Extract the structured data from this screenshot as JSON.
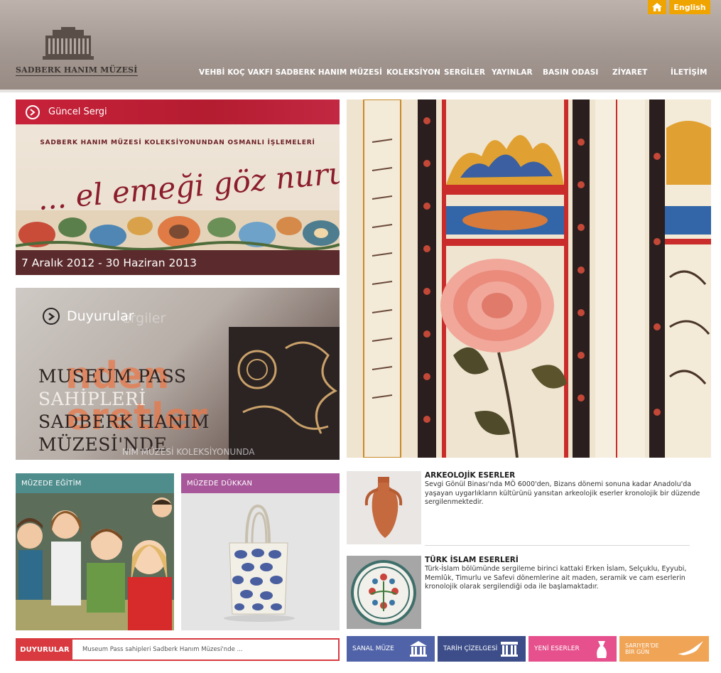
{
  "header": {
    "logo_text": "SADBERK HANIM MÜZESİ",
    "language_button": "English",
    "nav": [
      "VEHBİ KOÇ VAKFI SADBERK HANIM MÜZESİ",
      "KOLEKSİYON",
      "SERGİLER",
      "YAYINLAR",
      "BASIN ODASI",
      "ZİYARET",
      "İLETİŞİM"
    ]
  },
  "exhibition": {
    "label": "Güncel Sergi",
    "subtitle": "SADBERK HANIM MÜZESİ KOLEKSİYONUNDAN OSMANLI İŞLEMELERİ",
    "title": "... el emeği göz nuru",
    "dates": "7 Aralık 2012 - 30 Haziran 2013"
  },
  "announcement": {
    "label": "Duyurular",
    "ghost_text": "ergiler",
    "overlay_text": "nden",
    "overlay_text_2": "eretler",
    "lines": [
      "MUSEUM PASS",
      "SAHİPLERİ",
      "SADBERK HANIM",
      "MÜZESİ'NDE"
    ],
    "footer_text": "NIM MÜZESİ KOLEKSİYONUNDA"
  },
  "tiles": {
    "education": "MÜZEDE EĞİTİM",
    "shop": "MÜZEDE DÜKKAN"
  },
  "items": [
    {
      "title": "ARKEOLOJİK ESERLER",
      "text": "Sevgi Gönül Binası'nda MÖ 6000'den, Bizans dönemi sonuna kadar Anadolu'da yaşayan uygarlıkların kültürünü yansıtan arkeolojik eserler kronolojik bir düzende sergilenmektedir."
    },
    {
      "title": "TÜRK İSLAM ESERLERİ",
      "text": "Türk-İslam bölümünde sergileme birinci kattaki Erken İslam, Selçuklu, Eyyubi, Memlûk, Timurlu ve Safevi dönemlerine ait maden, seramik ve cam eserlerin kronolojik olarak sergilendiği oda ile başlamaktadır."
    }
  ],
  "news": {
    "label": "DUYURULAR",
    "text": "Museum Pass sahipleri Sadberk Hanım Müzesi'nde ..."
  },
  "buttons": {
    "virtual": "SANAL MÜZE",
    "timeline": "TARİH ÇİZELGESİ",
    "new_items": "YENİ ESERLER",
    "sariyer_1": "SARIYER'DE",
    "sariyer_2": "BİR GÜN"
  },
  "colors": {
    "header": "#a49892",
    "accent_orange": "#f0a400",
    "exhibit_red": "#c8223a",
    "edu_teal": "#4f8c8c",
    "shop_purple": "#a8579a",
    "news_red": "#d83a3f"
  },
  "icons": [
    "home-icon",
    "arrow-circle-icon",
    "museum-building-icon",
    "vase-icon",
    "bird-icon"
  ]
}
